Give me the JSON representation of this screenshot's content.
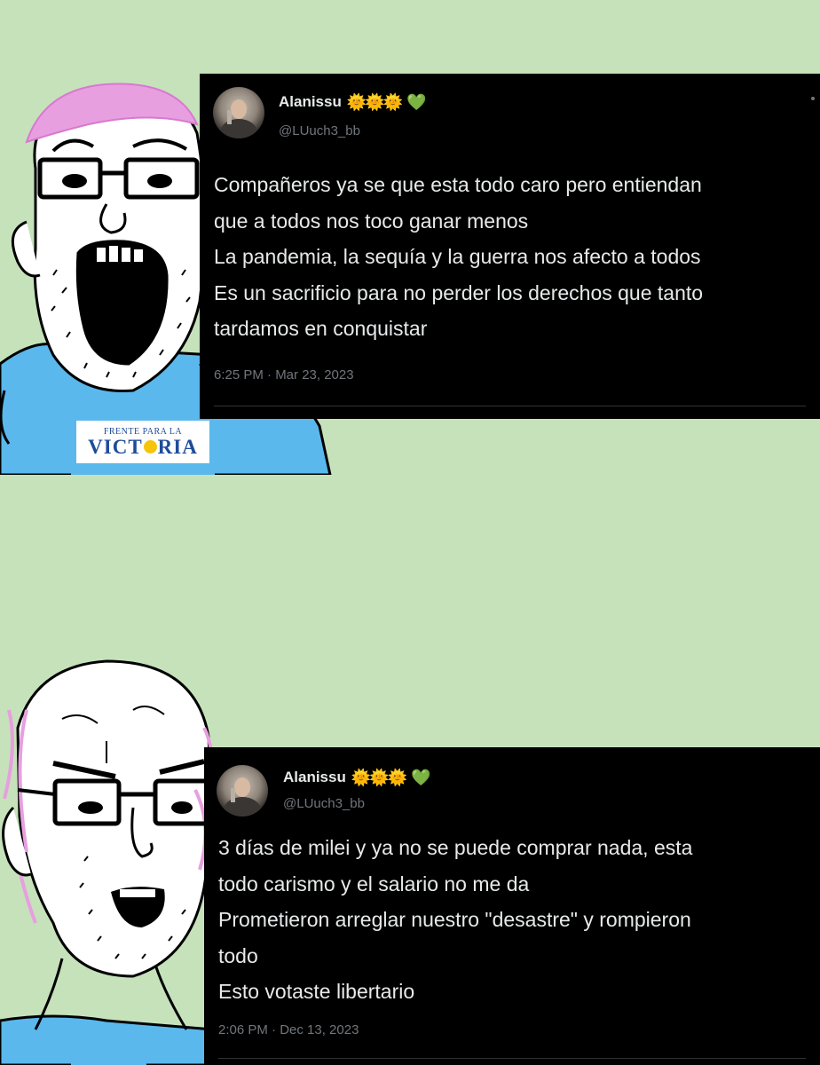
{
  "badge": {
    "top": "FRENTE PARA LA",
    "main_left": "VICT",
    "main_right": "RIA"
  },
  "tweets": [
    {
      "display_name": "Alanissu",
      "sun_emoji": "🌞🌞🌞",
      "heart_emoji": "💚",
      "handle": "@LUuch3_bb",
      "lines": [
        "Compañeros ya se que esta todo caro pero entiendan",
        "que a todos nos toco ganar menos",
        "La pandemia, la sequía y la guerra nos afecto a todos",
        "Es un sacrificio para no perder los derechos que tanto",
        "tardamos en conquistar"
      ],
      "meta": "6:25 PM · Mar 23, 2023"
    },
    {
      "display_name": "Alanissu",
      "sun_emoji": "🌞🌞🌞",
      "heart_emoji": "💚",
      "handle": "@LUuch3_bb",
      "lines": [
        "3 días de milei y ya no se puede comprar nada, esta",
        "todo carismo y el salario no me da",
        "Prometieron arreglar nuestro \"desastre\" y rompieron",
        "todo",
        "Esto votaste libertario"
      ],
      "meta": "2:06 PM · Dec 13, 2023"
    }
  ],
  "colors": {
    "background": "#c6e2bb",
    "tweet_bg": "#000000",
    "text": "#e7e9ea",
    "muted": "#71767b",
    "shirt_blue": "#5ab8ec",
    "hair_pink": "#e79fe0"
  }
}
